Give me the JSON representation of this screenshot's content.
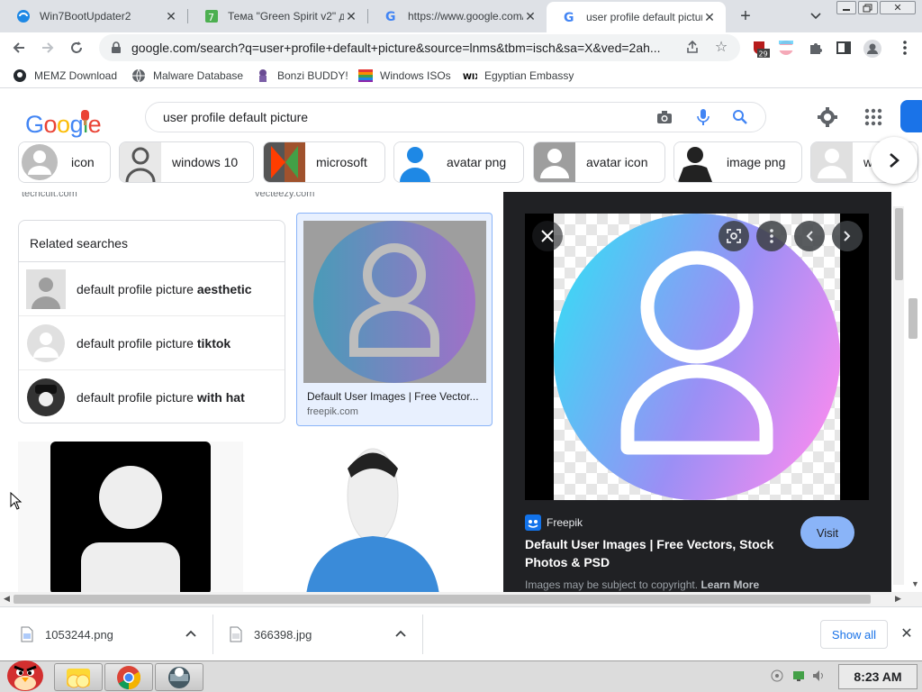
{
  "tabs": [
    {
      "title": "Win7BootUpdater2",
      "icon": "win7bootupdater-icon",
      "active": false
    },
    {
      "title": "Тема \"Green Spirit v2\" дл",
      "icon": "seven-forums-icon",
      "active": false
    },
    {
      "title": "https://www.google.com/",
      "icon": "google-icon",
      "active": false
    },
    {
      "title": "user profile default pictur",
      "icon": "google-icon",
      "active": true
    }
  ],
  "toolbar": {
    "url": "google.com/search?q=user+profile+default+picture&source=lnms&tbm=isch&sa=X&ved=2ah...",
    "extension_badge": "29"
  },
  "bookmarks": [
    {
      "label": "MEMZ Download",
      "icon": "github-icon"
    },
    {
      "label": "Malware Database",
      "icon": "globe-icon"
    },
    {
      "label": "Bonzi BUDDY!",
      "icon": "bonzi-icon"
    },
    {
      "label": "Windows ISOs",
      "icon": "windows-flag-icon"
    },
    {
      "label": "Egyptian Embassy",
      "icon": "wix-icon"
    }
  ],
  "google": {
    "logo": "Google",
    "query": "user profile default picture",
    "chips": [
      {
        "label": "icon"
      },
      {
        "label": "windows 10"
      },
      {
        "label": "microsoft"
      },
      {
        "label": "avatar png"
      },
      {
        "label": "avatar icon"
      },
      {
        "label": "image png"
      },
      {
        "label": "wi"
      }
    ]
  },
  "results": {
    "top_sources": [
      "techcult.com",
      "vecteezy.com"
    ],
    "related_title": "Related searches",
    "related": [
      {
        "prefix": "default profile picture ",
        "bold": "aesthetic"
      },
      {
        "prefix": "default profile picture ",
        "bold": "tiktok"
      },
      {
        "prefix": "default profile picture ",
        "bold": "with hat"
      }
    ],
    "selected": {
      "caption": "Default User Images | Free Vector...",
      "domain": "freepik.com"
    }
  },
  "preview": {
    "source": "Freepik",
    "title": "Default User Images | Free Vectors, Stock Photos & PSD",
    "visit_label": "Visit",
    "copyright": "Images may be subject to copyright.",
    "learn_more": "Learn More"
  },
  "downloads": {
    "items": [
      {
        "name": "1053244.png"
      },
      {
        "name": "366398.jpg"
      }
    ],
    "show_all": "Show all"
  },
  "taskbar": {
    "clock": "8:23 AM"
  },
  "colors": {
    "accent": "#1a73e8",
    "preview_bg": "#202124",
    "visit_button": "#8ab4f8"
  }
}
